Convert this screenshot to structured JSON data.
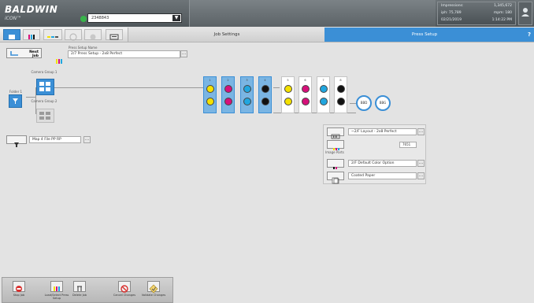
{
  "header": {
    "brand": "BALDWIN",
    "brand_sub": "iCON™",
    "job_number": "2348843",
    "counter": {
      "impressions_label": "Impressions:",
      "impressions_value": "1,345,672",
      "iph_label": "iph: 75,789",
      "mpm_label": "mpm: 180",
      "date": "02/21/2019",
      "time": "1:14:22 PM"
    }
  },
  "tabs": {
    "job_settings": "Job Settings",
    "press_setup": "Press Setup",
    "help": "?"
  },
  "next_job": {
    "label": "Next Job"
  },
  "press_setup_name": {
    "label": "Press Setup Name",
    "value": "2/7 Press Setup - 2x8 Perfect"
  },
  "feeder": {
    "label": "Folder 1"
  },
  "camera_groups": [
    {
      "label": "Camera Group 1"
    },
    {
      "label": "Camera Group 2"
    }
  ],
  "units_left": [
    {
      "top": "yellow",
      "bottom": "yellow",
      "selected": true
    },
    {
      "top": "magenta",
      "bottom": "magenta",
      "selected": true
    },
    {
      "top": "cyan",
      "bottom": "cyan",
      "selected": true
    },
    {
      "top": "black",
      "bottom": "black",
      "selected": true
    }
  ],
  "units_right": [
    {
      "top": "yellow",
      "bottom": "yellow",
      "selected": false
    },
    {
      "top": "magenta",
      "bottom": "magenta",
      "selected": false
    },
    {
      "top": "cyan",
      "bottom": "cyan",
      "selected": false
    },
    {
      "top": "black",
      "bottom": "black",
      "selected": false
    }
  ],
  "dryers": [
    "BBD",
    "BBG"
  ],
  "map": {
    "value": "Map 4 File PP RP"
  },
  "panel": {
    "layout": "~2/F Layout - 2x8 Perfect",
    "count": "7651",
    "inkparts_label": "Image Parts",
    "color_option": "2/F Default Color Option",
    "paper": "Coated Paper"
  },
  "bottom_buttons": [
    {
      "label": "Stop Job"
    },
    {
      "label": "Load/Select Press Setup"
    },
    {
      "label": "Delete Job"
    },
    {
      "label": "Cancel Changes"
    },
    {
      "label": "Validate Changes"
    }
  ],
  "colors": {
    "accent": "#3b8fd6",
    "yellow": "#f4e100",
    "magenta": "#d6117a",
    "cyan": "#21a6df",
    "black": "#111111"
  }
}
